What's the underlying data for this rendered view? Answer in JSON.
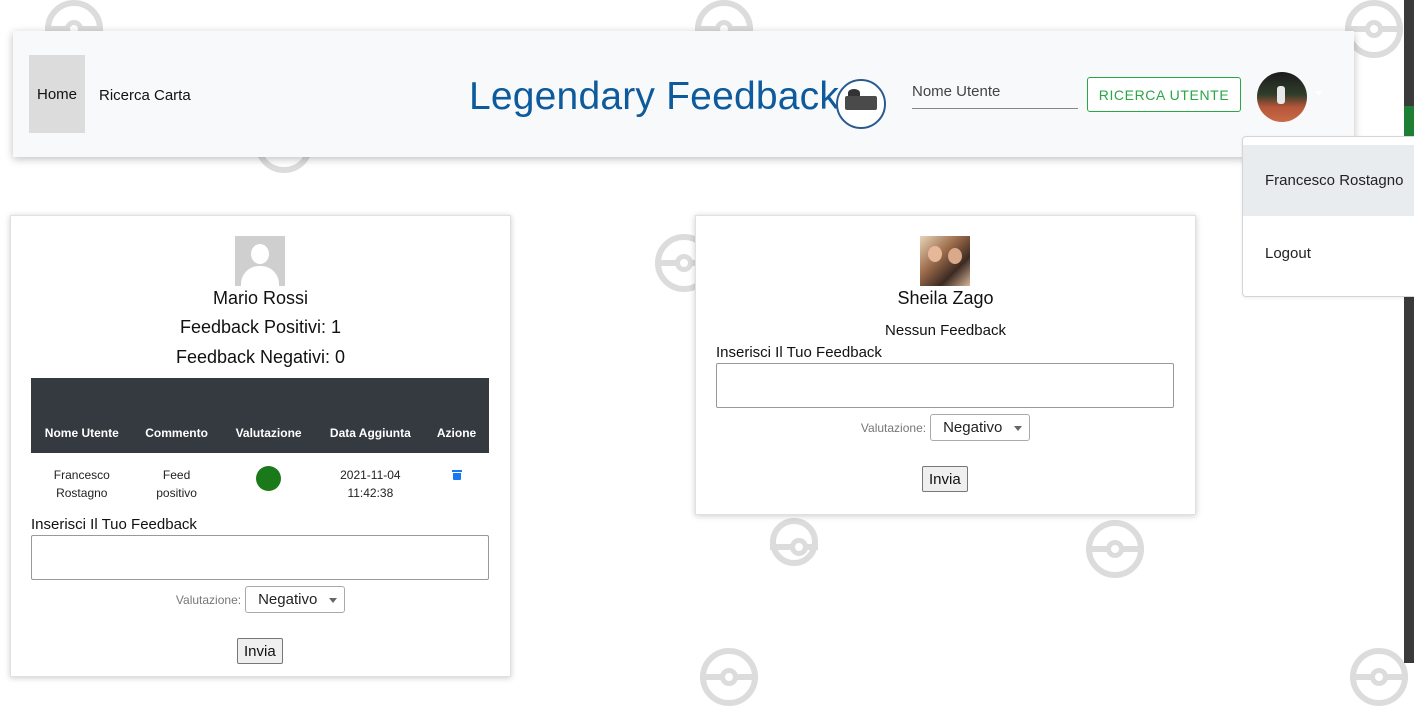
{
  "navbar": {
    "home": "Home",
    "ricerca_carta": "Ricerca Carta",
    "brand": "Legendary Feedback",
    "search_placeholder": "Nome Utente",
    "search_button": "RICERCA UTENTE"
  },
  "user_menu": {
    "name": "Francesco Rostagno",
    "logout": "Logout"
  },
  "cards": [
    {
      "name": "Mario Rossi",
      "positive": "Feedback Positivi: 1",
      "negative": "Feedback Negativi: 0",
      "table": {
        "headers": [
          "Nome Utente",
          "Commento",
          "Valutazione",
          "Data Aggiunta",
          "Azione"
        ],
        "rows": [
          {
            "user": "Francesco Rostagno",
            "comment": "Feed positivo",
            "rating": "positive",
            "date": "2021-11-04 11:42:38"
          }
        ]
      },
      "feedback_label": "Inserisci Il Tuo Feedback",
      "valutazione_label": "Valutazione:",
      "valutazione_value": "Negativo",
      "submit": "Invia"
    },
    {
      "name": "Sheila Zago",
      "no_feedback": "Nessun Feedback",
      "feedback_label": "Inserisci Il Tuo Feedback",
      "valutazione_label": "Valutazione:",
      "valutazione_value": "Negativo",
      "submit": "Invia"
    }
  ],
  "colors": {
    "brand": "#0d5a9c",
    "success": "#28a745",
    "table_header": "#343a40",
    "positive_dot": "#1a7a1a",
    "trash_icon": "#1877f2"
  }
}
